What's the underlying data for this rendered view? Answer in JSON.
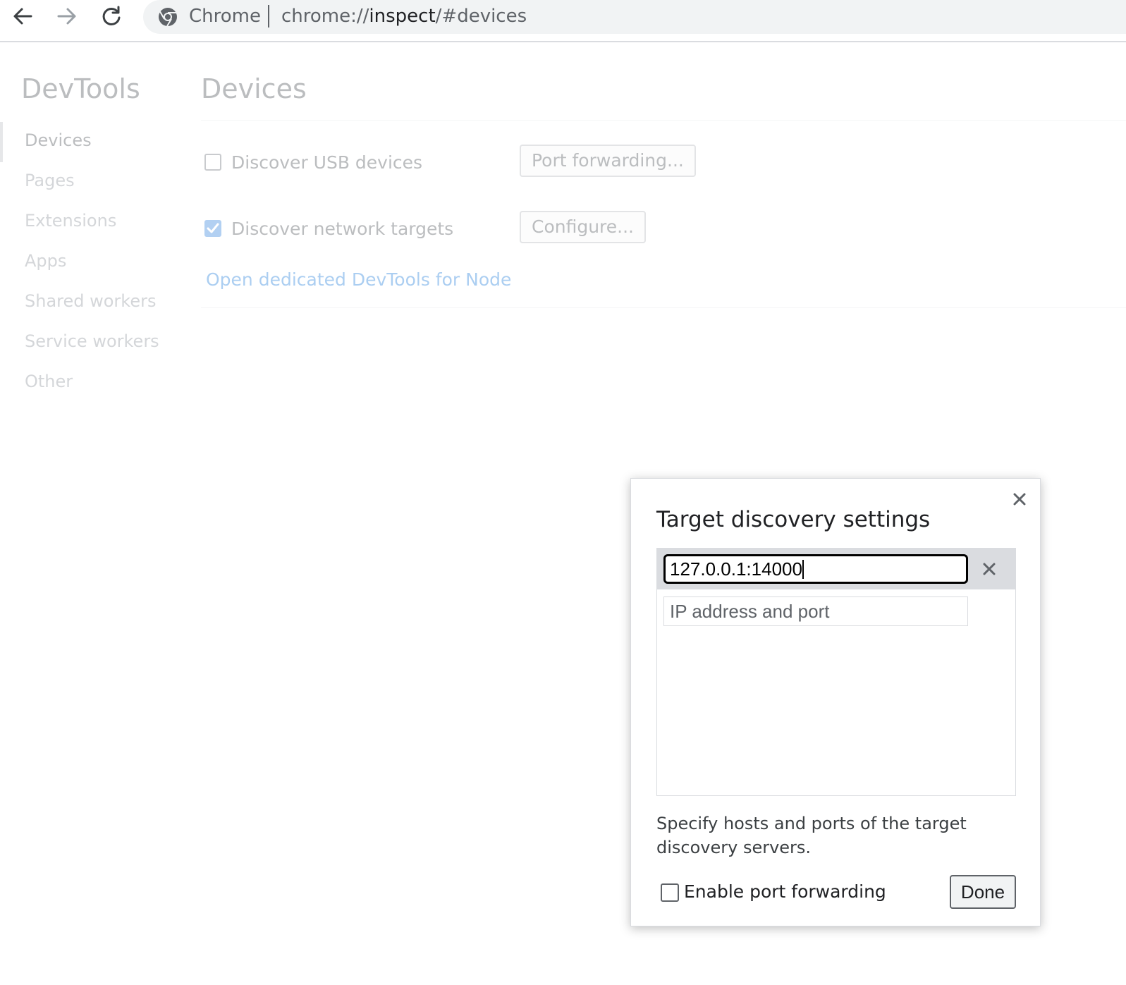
{
  "browser": {
    "chip_label": "Chrome",
    "url_scheme": "chrome://",
    "url_host": "inspect",
    "url_path": "/#devices"
  },
  "sidebar": {
    "title": "DevTools",
    "items": [
      {
        "label": "Devices",
        "selected": true
      },
      {
        "label": "Pages"
      },
      {
        "label": "Extensions"
      },
      {
        "label": "Apps"
      },
      {
        "label": "Shared workers"
      },
      {
        "label": "Service workers"
      },
      {
        "label": "Other"
      }
    ]
  },
  "main": {
    "title": "Devices",
    "usb": {
      "label": "Discover USB devices",
      "checked": false,
      "button": "Port forwarding..."
    },
    "network": {
      "label": "Discover network targets",
      "checked": true,
      "button": "Configure..."
    },
    "node_link": "Open dedicated DevTools for Node"
  },
  "dialog": {
    "title": "Target discovery settings",
    "entries": [
      "127.0.0.1:14000"
    ],
    "new_entry_placeholder": "IP address and port",
    "help_text": "Specify hosts and ports of the target discovery servers.",
    "port_forwarding_label": "Enable port forwarding",
    "port_forwarding_checked": false,
    "done_label": "Done"
  },
  "colors": {
    "checkbox_checked": "#4a90e2",
    "link": "#3a8be0",
    "active_row": "#dadce0"
  }
}
